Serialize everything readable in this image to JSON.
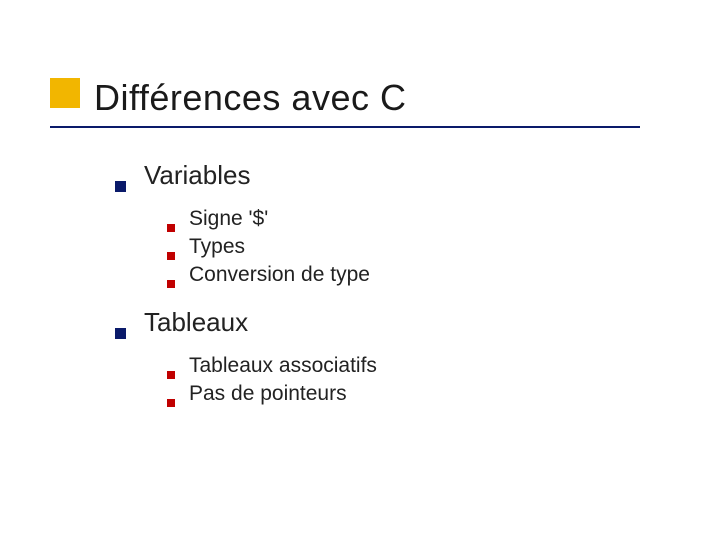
{
  "title": "Différences avec C",
  "sections": [
    {
      "label": "Variables",
      "items": [
        {
          "label": "Signe '$'"
        },
        {
          "label": "Types"
        },
        {
          "label": "Conversion de type"
        }
      ]
    },
    {
      "label": "Tableaux",
      "items": [
        {
          "label": "Tableaux associatifs"
        },
        {
          "label": "Pas de pointeurs"
        }
      ]
    }
  ]
}
